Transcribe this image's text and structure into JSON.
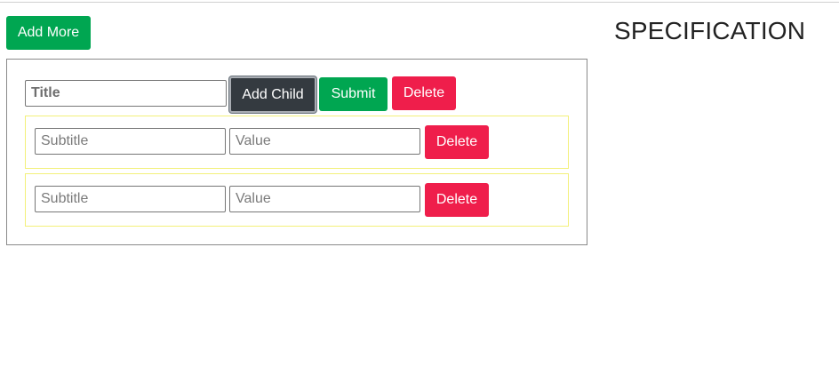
{
  "toolbar": {
    "add_more_label": "Add More"
  },
  "heading": {
    "specification_label": "SPECIFICATION"
  },
  "group": {
    "title_placeholder": "Title",
    "title_value": "",
    "add_child_label": "Add Child",
    "submit_label": "Submit",
    "delete_label": "Delete",
    "children": [
      {
        "subtitle_placeholder": "Subtitle",
        "subtitle_value": "",
        "value_placeholder": "Value",
        "value_value": "",
        "delete_label": "Delete"
      },
      {
        "subtitle_placeholder": "Subtitle",
        "subtitle_value": "",
        "value_placeholder": "Value",
        "value_value": "",
        "delete_label": "Delete"
      }
    ]
  },
  "colors": {
    "success": "#00a651",
    "danger": "#ef1e4b",
    "dark": "#343a40",
    "child_border": "#f3f07a",
    "card_border": "#8a8a8a"
  }
}
